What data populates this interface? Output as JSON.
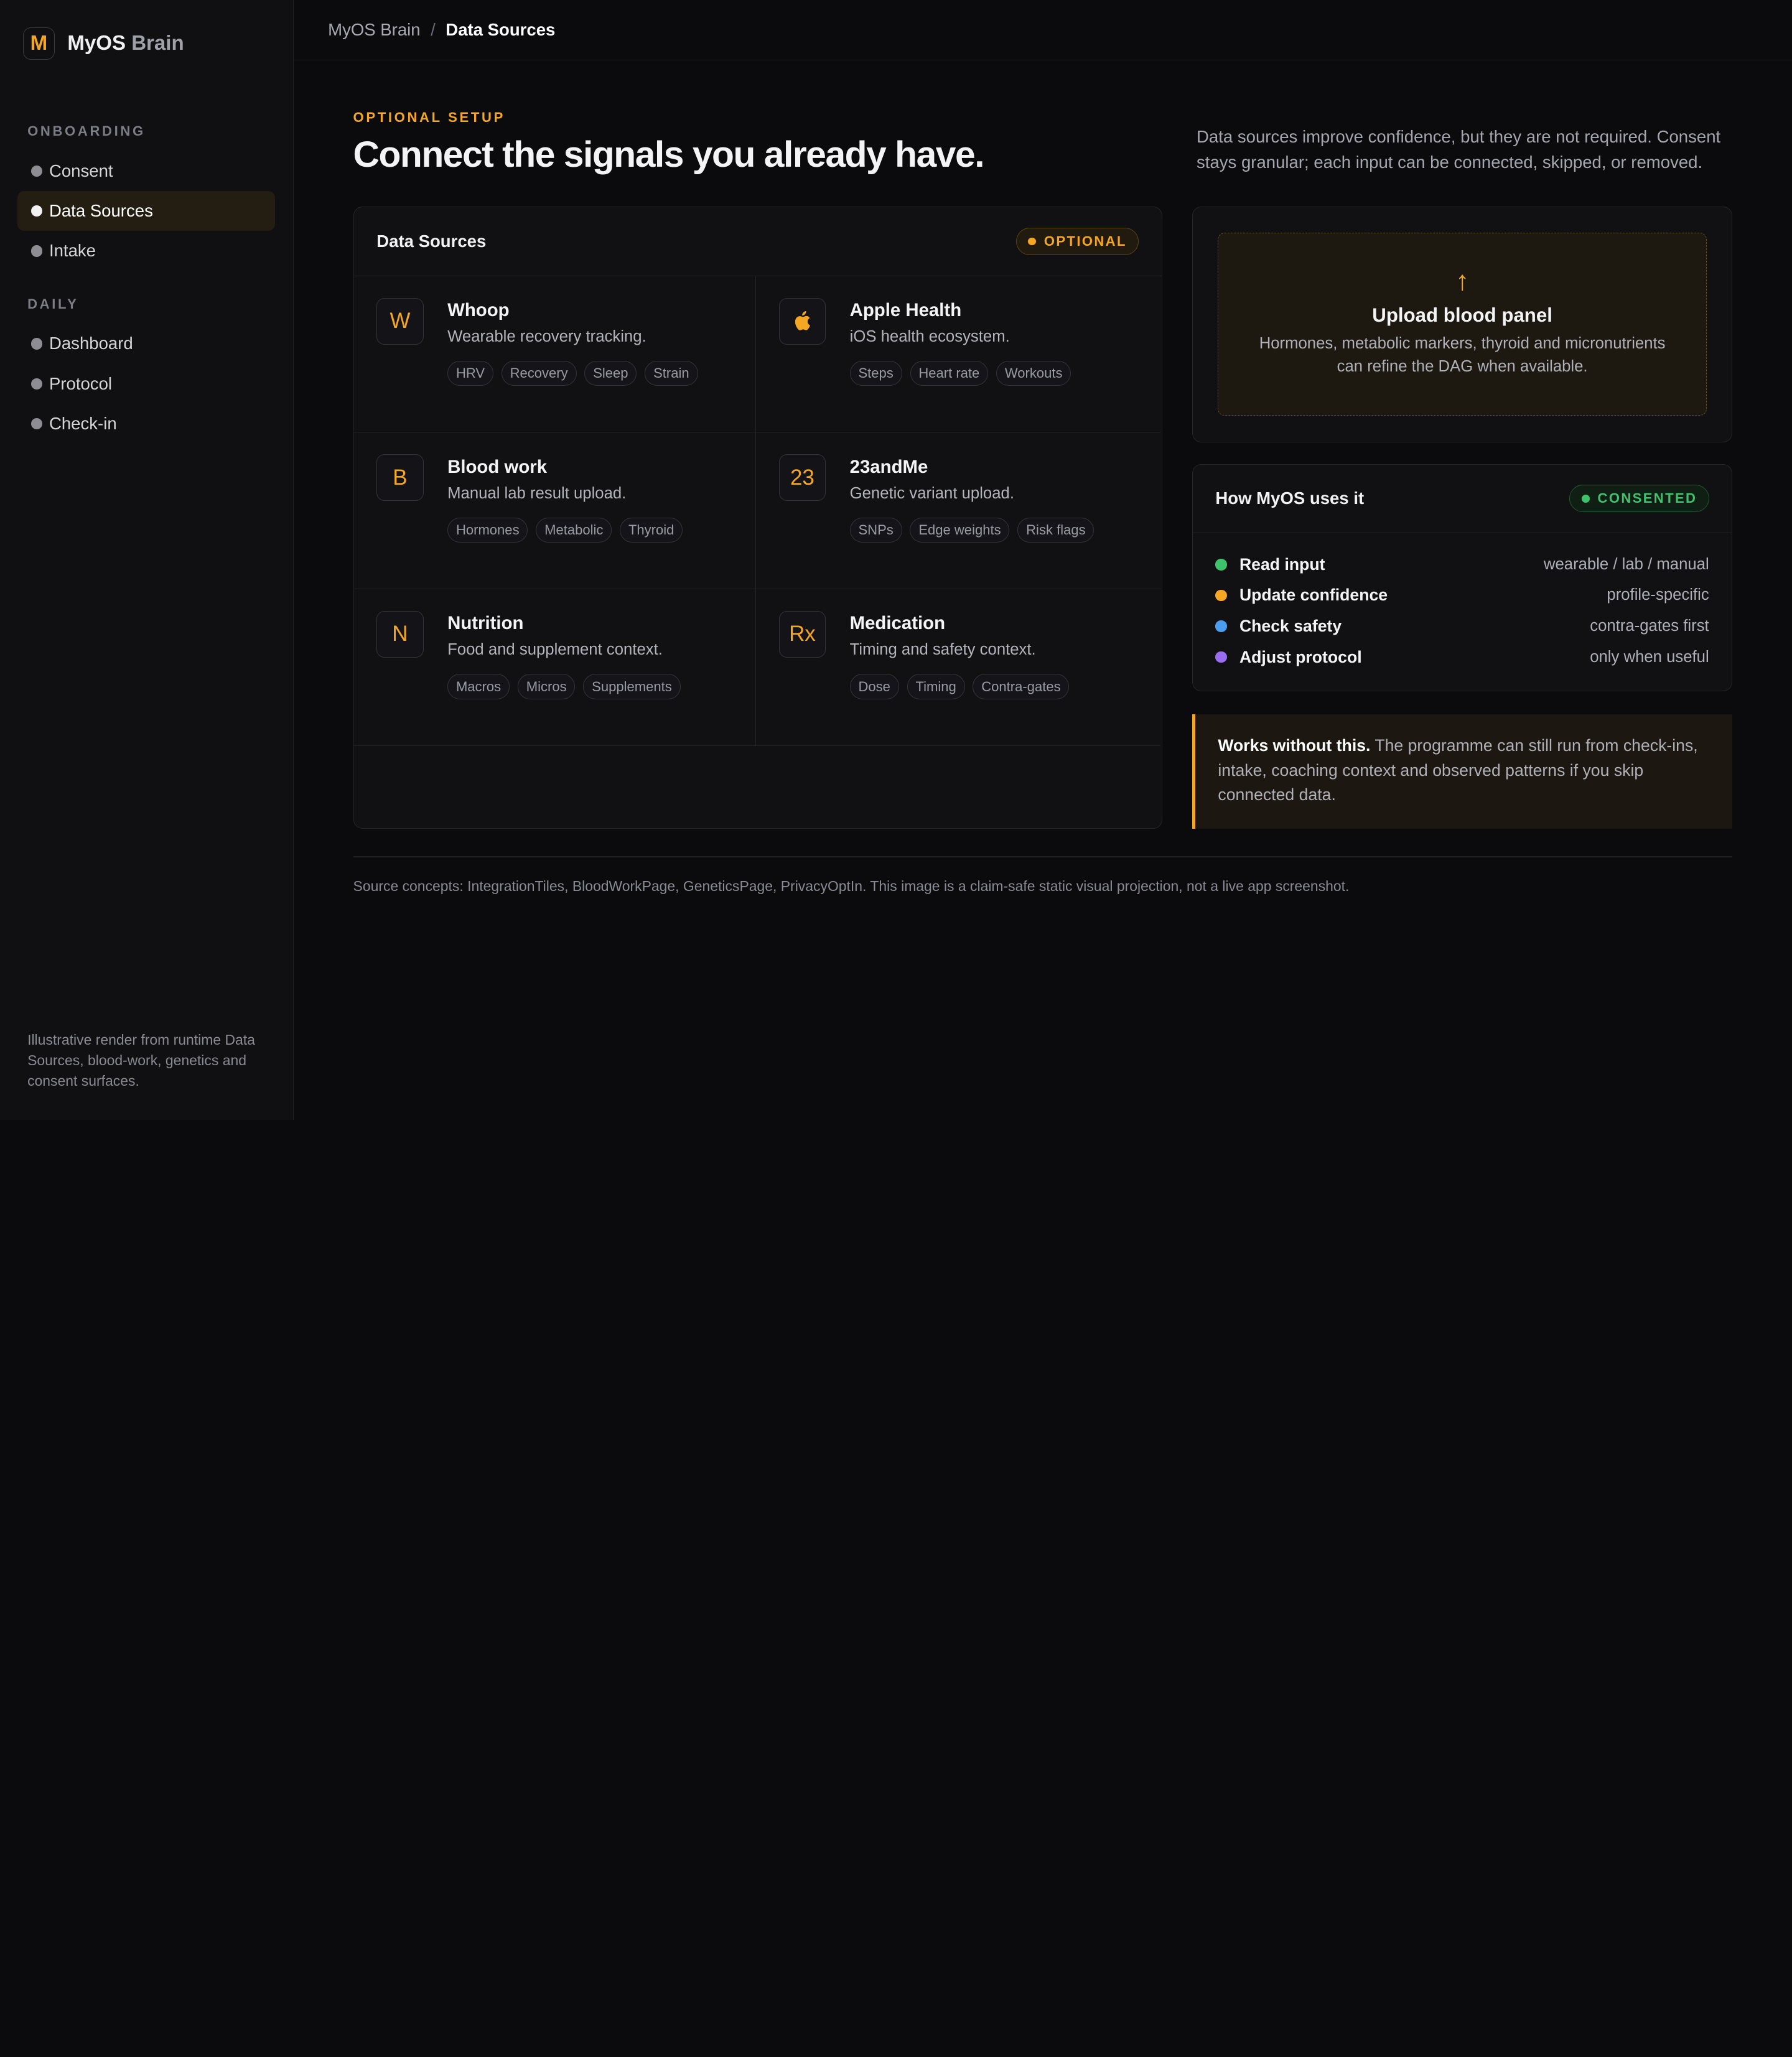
{
  "brand": {
    "logo_letter": "M",
    "name": "MyOS",
    "name_suffix": "Brain"
  },
  "sidebar": {
    "section_onboarding": "ONBOARDING",
    "onboarding_items": [
      {
        "label": "Consent"
      },
      {
        "label": "Data Sources",
        "active": true
      },
      {
        "label": "Intake"
      }
    ],
    "section_daily": "DAILY",
    "daily_items": [
      {
        "label": "Dashboard"
      },
      {
        "label": "Protocol"
      },
      {
        "label": "Check-in"
      }
    ],
    "footer_note": "Illustrative render from runtime Data Sources, blood-work, genetics and consent surfaces."
  },
  "breadcrumb": {
    "root": "MyOS Brain",
    "separator": "/",
    "current": "Data Sources"
  },
  "header": {
    "eyebrow": "OPTIONAL SETUP",
    "title": "Connect the signals you already have.",
    "intro": "Data sources improve confidence, but they are not required. Consent stays granular; each input can be connected, skipped, or removed."
  },
  "data_sources": {
    "title": "Data Sources",
    "badge": "OPTIONAL",
    "tiles": [
      {
        "icon_text": "W",
        "name": "Whoop",
        "desc": "Wearable recovery tracking.",
        "tags": [
          "HRV",
          "Recovery",
          "Sleep",
          "Strain"
        ]
      },
      {
        "icon_text": "",
        "icon": "apple-icon",
        "name": "Apple Health",
        "desc": "iOS health ecosystem.",
        "tags": [
          "Steps",
          "Heart rate",
          "Workouts"
        ]
      },
      {
        "icon_text": "B",
        "name": "Blood work",
        "desc": "Manual lab result upload.",
        "tags": [
          "Hormones",
          "Metabolic",
          "Thyroid"
        ]
      },
      {
        "icon_text": "23",
        "name": "23andMe",
        "desc": "Genetic variant upload.",
        "tags": [
          "SNPs",
          "Edge weights",
          "Risk flags"
        ]
      },
      {
        "icon_text": "N",
        "name": "Nutrition",
        "desc": "Food and supplement context.",
        "tags": [
          "Macros",
          "Micros",
          "Supplements"
        ]
      },
      {
        "icon_text": "Rx",
        "name": "Medication",
        "desc": "Timing and safety context.",
        "tags": [
          "Dose",
          "Timing",
          "Contra-gates"
        ]
      }
    ]
  },
  "upload": {
    "arrow": "↑",
    "title": "Upload blood panel",
    "desc": "Hormones, metabolic markers, thyroid and micronutrients can refine the DAG when available."
  },
  "uses": {
    "title": "How MyOS uses it",
    "badge": "CONSENTED",
    "rows": [
      {
        "label": "Read input",
        "value": "wearable / lab / manual",
        "color": "#3ec36a"
      },
      {
        "label": "Update confidence",
        "value": "profile-specific",
        "color": "#f5a623"
      },
      {
        "label": "Check safety",
        "value": "contra-gates first",
        "color": "#4a9df0"
      },
      {
        "label": "Adjust protocol",
        "value": "only when useful",
        "color": "#9b6cf0"
      }
    ]
  },
  "note": {
    "bold": "Works without this.",
    "text": " The programme can still run from check-ins, intake, coaching context and observed patterns if you skip connected data."
  },
  "footnote": "Source concepts: IntegrationTiles, BloodWorkPage, GeneticsPage, PrivacyOptIn. This image is a claim-safe static visual projection, not a live app screenshot.",
  "colors": {
    "accent": "#f5a623",
    "consented": "#3ec36a",
    "background": "#0b0b0e"
  }
}
